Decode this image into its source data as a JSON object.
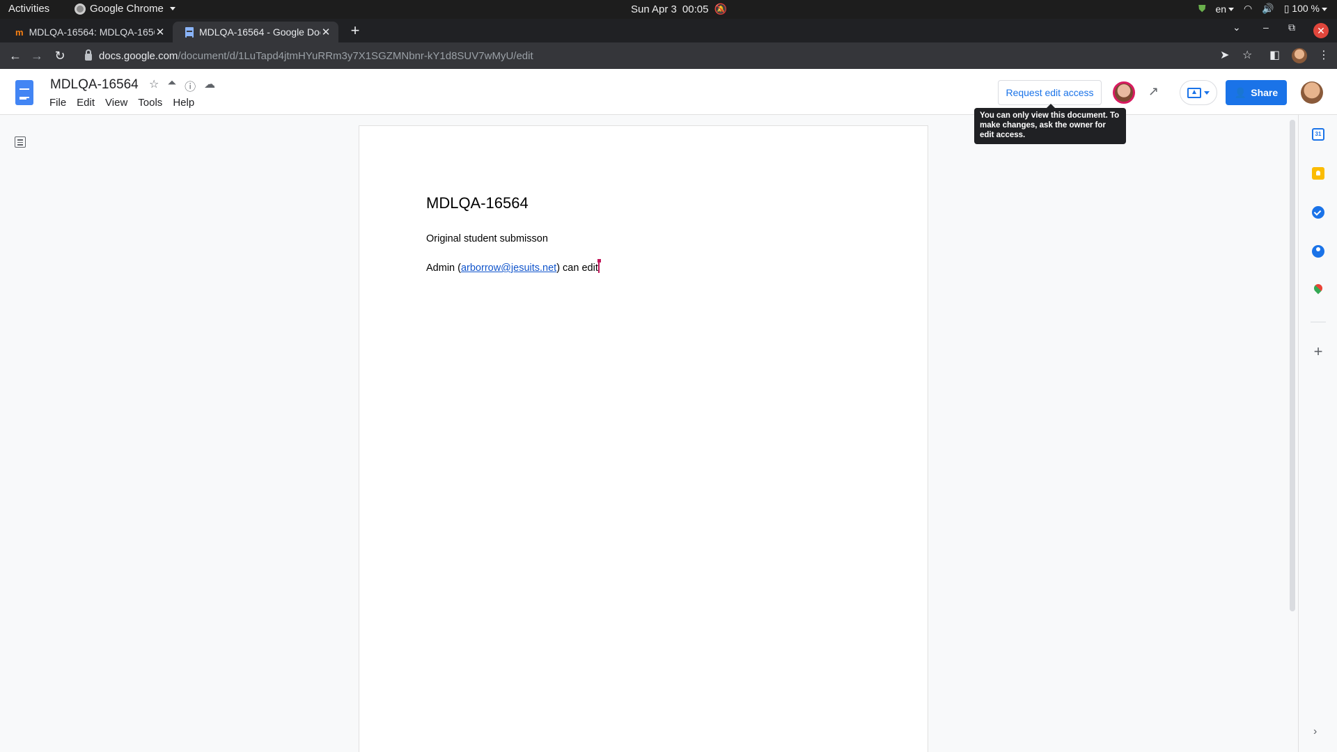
{
  "system_bar": {
    "activities": "Activities",
    "app_name": "Google Chrome",
    "date": "Sun Apr 3",
    "time": "00:05",
    "language": "en",
    "battery": "100 %"
  },
  "browser": {
    "tabs": [
      {
        "title": "MDLQA-16564: MDLQA-16564",
        "favicon": "moodle-icon",
        "active": false
      },
      {
        "title": "MDLQA-16564 - Google Docs",
        "favicon": "google-docs-icon",
        "active": true
      }
    ],
    "new_tab": "+",
    "url_domain": "docs.google.com",
    "url_path": "/document/d/1LuTapd4jtmHYuRRm3y7X1SGZMNbnr-kY1d8SUV7wMyU/edit"
  },
  "docs": {
    "title": "MDLQA-16564",
    "menu": [
      "File",
      "Edit",
      "View",
      "Tools",
      "Help"
    ],
    "request_edit_label": "Request edit access",
    "share_label": "Share",
    "tooltip": "You can only view this document. To make changes, ask the owner for edit access."
  },
  "document": {
    "heading": "MDLQA-16564",
    "line1": "Original student submisson",
    "line2_prefix": "Admin (",
    "line2_link": "arborrow@jesuits.net",
    "line2_suffix": ") can edit"
  },
  "side_panel": {
    "calendar_day": "31",
    "icons": [
      "calendar-icon",
      "keep-icon",
      "tasks-icon",
      "contacts-icon",
      "maps-icon",
      "add-icon"
    ]
  },
  "colors": {
    "share_blue": "#1a73e8",
    "collab_cursor": "#c2185b",
    "link": "#1155cc"
  }
}
